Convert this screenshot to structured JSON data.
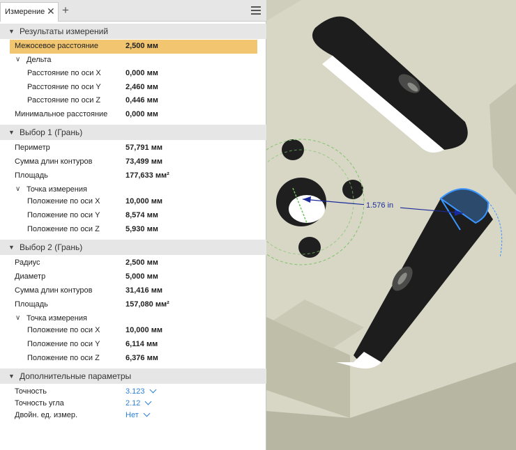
{
  "tab": {
    "label": "Измерение"
  },
  "results": {
    "title": "Результаты измерений",
    "center_distance": {
      "label": "Межосевое расстояние",
      "value": "2,500 мм"
    },
    "delta": {
      "label": "Дельта"
    },
    "dx": {
      "label": "Расстояние по оси X",
      "value": "0,000 мм"
    },
    "dy": {
      "label": "Расстояние по оси Y",
      "value": "2,460 мм"
    },
    "dz": {
      "label": "Расстояние по оси Z",
      "value": "0,446 мм"
    },
    "min_distance": {
      "label": "Минимальное расстояние",
      "value": "0,000 мм"
    }
  },
  "sel1": {
    "title": "Выбор 1 (Грань)",
    "perimeter": {
      "label": "Периметр",
      "value": "57,791 мм"
    },
    "loops": {
      "label": "Сумма длин контуров",
      "value": "73,499 мм"
    },
    "area": {
      "label": "Площадь",
      "value": "177,633 мм²"
    },
    "point": {
      "label": "Точка измерения"
    },
    "px": {
      "label": "Положение по оси X",
      "value": "10,000 мм"
    },
    "py": {
      "label": "Положение по оси Y",
      "value": "8,574 мм"
    },
    "pz": {
      "label": "Положение по оси Z",
      "value": "5,930 мм"
    }
  },
  "sel2": {
    "title": "Выбор 2 (Грань)",
    "radius": {
      "label": "Радиус",
      "value": "2,500 мм"
    },
    "diameter": {
      "label": "Диаметр",
      "value": "5,000 мм"
    },
    "loops": {
      "label": "Сумма длин контуров",
      "value": "31,416 мм"
    },
    "area": {
      "label": "Площадь",
      "value": "157,080 мм²"
    },
    "point": {
      "label": "Точка измерения"
    },
    "px": {
      "label": "Положение по оси X",
      "value": "10,000 мм"
    },
    "py": {
      "label": "Положение по оси Y",
      "value": "6,114 мм"
    },
    "pz": {
      "label": "Положение по оси Z",
      "value": "6,376 мм"
    }
  },
  "params": {
    "title": "Дополнительные параметры",
    "precision": {
      "label": "Точность",
      "value": "3.123"
    },
    "angle_precision": {
      "label": "Точность угла",
      "value": "2.12"
    },
    "dual_units": {
      "label": "Двойн. ед. измер.",
      "value": "Нет"
    }
  },
  "viewport": {
    "dimension_label": "1.576 in"
  },
  "colors": {
    "highlight": "#f2c670",
    "accent": "#2a7fd4",
    "section_bg": "#e6e6e6"
  }
}
